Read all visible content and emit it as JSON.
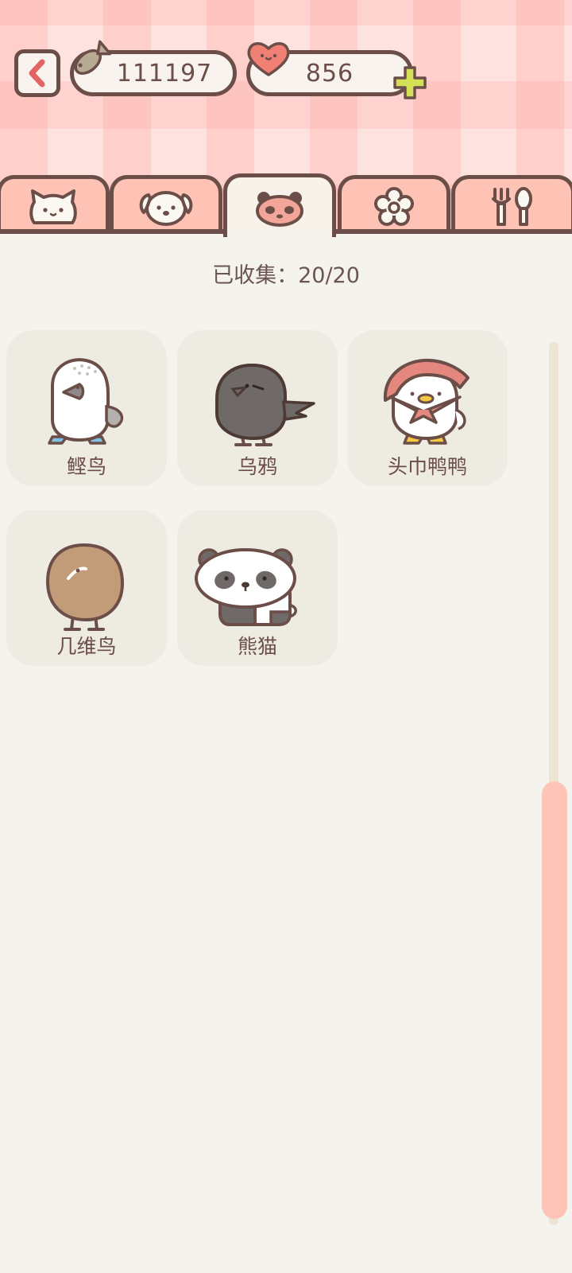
{
  "header": {
    "fish_count": "111197",
    "heart_count": "856"
  },
  "tabs": [
    {
      "icon": "cat-face-icon",
      "active": false
    },
    {
      "icon": "dog-face-icon",
      "active": false
    },
    {
      "icon": "panda-face-icon",
      "active": true
    },
    {
      "icon": "flower-icon",
      "active": false
    },
    {
      "icon": "fork-spoon-icon",
      "active": false
    }
  ],
  "collection": {
    "collected_text": "已收集：20/20",
    "items": [
      {
        "name": "鲣鸟",
        "icon": "booby-bird-icon"
      },
      {
        "name": "乌鸦",
        "icon": "crow-icon"
      },
      {
        "name": "头巾鸭鸭",
        "icon": "bandana-duck-icon"
      },
      {
        "name": "几维鸟",
        "icon": "kiwi-bird-icon"
      },
      {
        "name": "熊猫",
        "icon": "panda-icon"
      }
    ]
  },
  "colors": {
    "outline": "#6b4e48",
    "tab_bg": "#ffc3b6",
    "card_bg": "#eeebe2",
    "scroll_thumb": "#ffc4b8",
    "plus_green": "#d3df57"
  }
}
